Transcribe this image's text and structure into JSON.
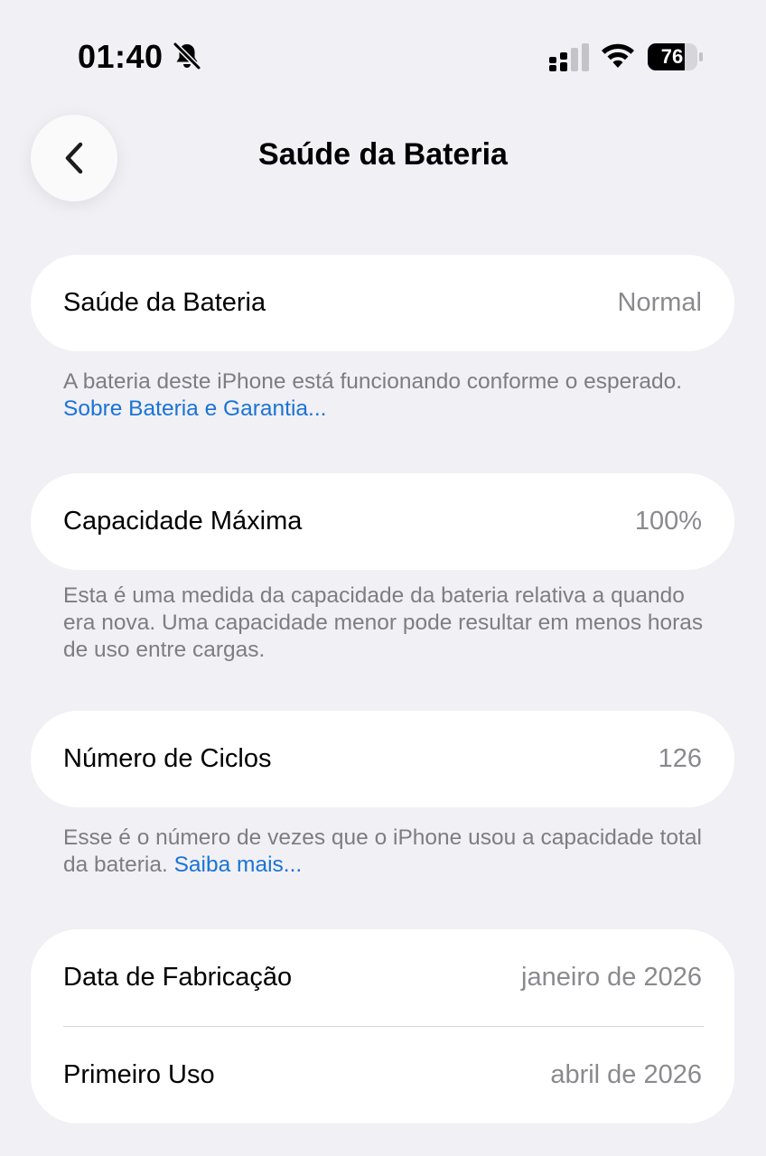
{
  "status_bar": {
    "time": "01:40",
    "battery_level": "76",
    "icons": [
      "bell-slash-icon",
      "cellular-signal-icon",
      "wifi-icon",
      "battery-icon"
    ]
  },
  "nav": {
    "title": "Saúde da Bateria",
    "back_icon": "chevron-left-icon"
  },
  "battery_health": {
    "label": "Saúde da Bateria",
    "value": "Normal",
    "footnote_text": "A bateria deste iPhone está funcionando conforme o esperado.",
    "footnote_link": "Sobre Bateria e Garantia..."
  },
  "max_capacity": {
    "label": "Capacidade Máxima",
    "value": "100%",
    "footnote_text": "Esta é uma medida da capacidade da bateria relativa a quando era nova. Uma capacidade menor pode resultar em menos horas de uso entre cargas."
  },
  "cycle_count": {
    "label": "Número de Ciclos",
    "value": "126",
    "footnote_text": "Esse é o número de vezes que o iPhone usou a capacidade total da bateria.",
    "footnote_link": "Saiba mais..."
  },
  "dates": {
    "manufacture_label": "Data de Fabricação",
    "manufacture_value": "janeiro de 2026",
    "first_use_label": "Primeiro Uso",
    "first_use_value": "abril de 2026"
  },
  "colors": {
    "background": "#f0f0f5",
    "card": "#ffffff",
    "secondary_text": "#8a8a8e",
    "link": "#1a73d6"
  }
}
